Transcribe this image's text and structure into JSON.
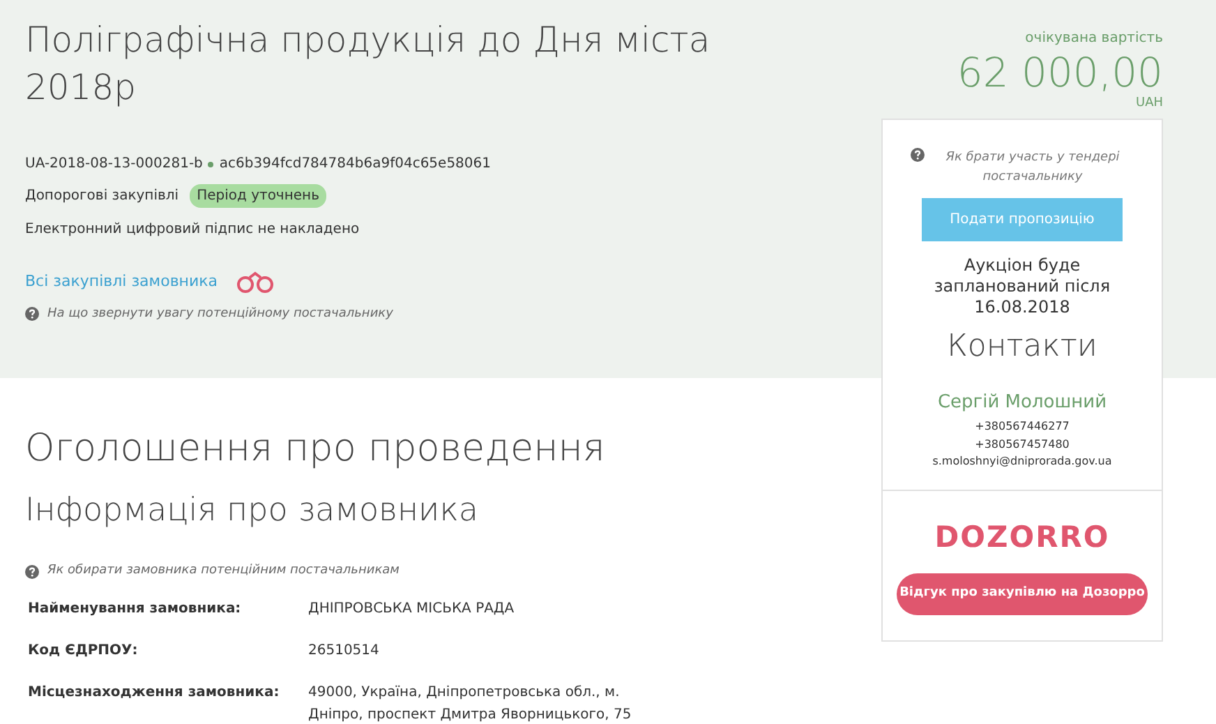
{
  "title": "Поліграфічна продукція до Дня міста 2018р",
  "tender_id": "UA-2018-08-13-000281-b",
  "hash": "ac6b394fcd784784b6a9f04c65e58061",
  "procedure": "Допорогові закупівлі",
  "status_badge": "Період уточнень",
  "signature_note": "Електронний цифровий підпис не накладено",
  "customer_link": "Всі закупівлі замовника",
  "hint_supplier": "На що звернути увагу потенційному постачальнику",
  "expected_value": {
    "label": "очікувана вартість",
    "amount": "62 000,00",
    "currency": "UAH"
  },
  "sidebar": {
    "hint": "Як брати участь у тендері постачальнику",
    "submit_button": "Подати пропозицію",
    "auction_note": "Аукціон буде запланований після 16.08.2018",
    "contacts_title": "Контакти",
    "contact_name": "Сергій Молошний",
    "phones": [
      "+380567446277",
      "+380567457480"
    ],
    "email": "s.moloshnyi@dniprorada.gov.ua",
    "logo": "DOZORRO",
    "feedback_button": "Відгук про закупівлю на Дозорро"
  },
  "announcement_title": "Оголошення про проведення",
  "section_title": "Інформація про замовника",
  "hint_customer": "Як обирати замовника потенційним постачальникам",
  "fields": [
    {
      "label": "Найменування замовника:",
      "value": "ДНІПРОВСЬКА МІСЬКА РАДА"
    },
    {
      "label": "Код ЄДРПОУ:",
      "value": "26510514"
    },
    {
      "label": "Місцезнаходження замовника:",
      "value": "49000, Україна, Дніпропетровська обл., м. Дніпро, проспект Дмитра Яворницького, 75"
    }
  ]
}
